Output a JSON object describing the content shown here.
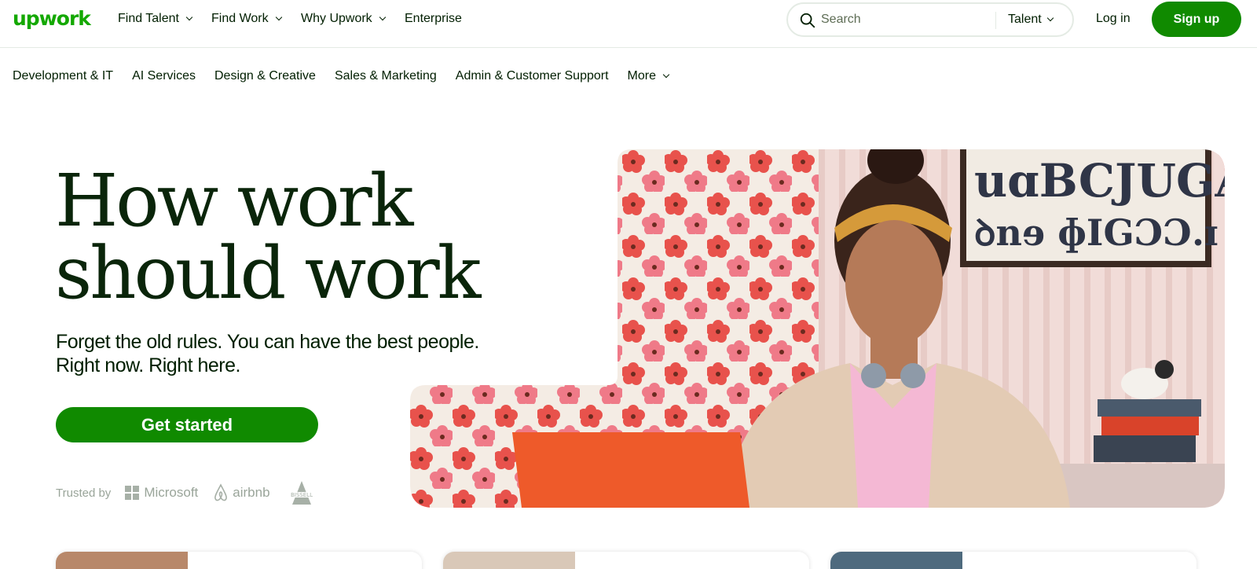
{
  "header": {
    "logo": "upwork",
    "nav": [
      {
        "label": "Find Talent",
        "has_dropdown": true
      },
      {
        "label": "Find Work",
        "has_dropdown": true
      },
      {
        "label": "Why Upwork",
        "has_dropdown": true
      },
      {
        "label": "Enterprise",
        "has_dropdown": false
      }
    ],
    "search": {
      "placeholder": "Search",
      "scope": "Talent"
    },
    "login_label": "Log in",
    "signup_label": "Sign up"
  },
  "categories": [
    {
      "label": "Development & IT"
    },
    {
      "label": "AI Services"
    },
    {
      "label": "Design & Creative"
    },
    {
      "label": "Sales & Marketing"
    },
    {
      "label": "Admin & Customer Support"
    },
    {
      "label": "More",
      "has_dropdown": true
    }
  ],
  "hero": {
    "title_line1": "How work",
    "title_line2": "should work",
    "subtitle_line1": "Forget the old rules. You can have the best people.",
    "subtitle_line2": "Right now. Right here.",
    "cta_label": "Get started",
    "trusted_label": "Trusted by",
    "trusted_logos": [
      "Microsoft",
      "airbnb",
      "Bissell"
    ]
  },
  "colors": {
    "brand_green": "#14a800",
    "button_green": "#108a00",
    "text_dark": "#001e00"
  },
  "icons": {
    "search": "search-icon",
    "chevron": "chevron-down-icon"
  }
}
